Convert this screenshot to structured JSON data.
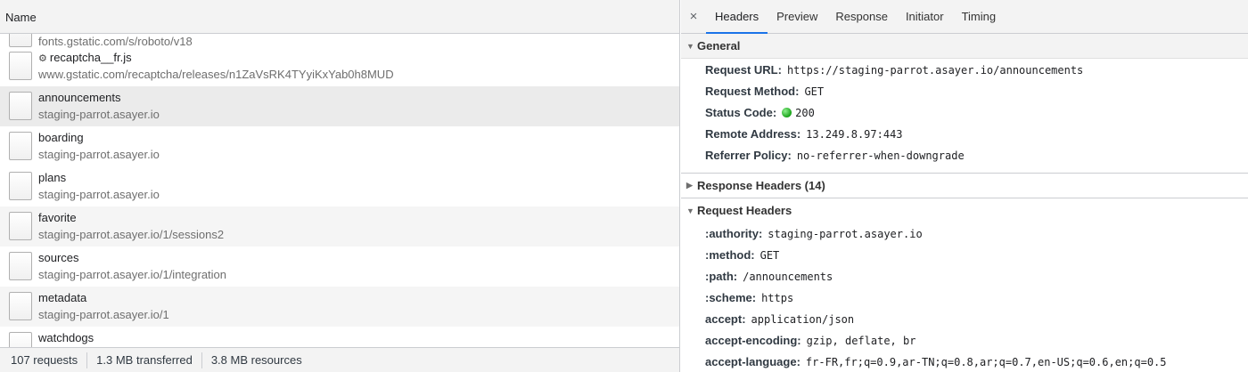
{
  "list": {
    "column_header": "Name",
    "rows": [
      {
        "name": "",
        "url": "fonts.gstatic.com/s/roboto/v18"
      },
      {
        "name": "recaptcha__fr.js",
        "url": "www.gstatic.com/recaptcha/releases/n1ZaVsRK4TYyiKxYab0h8MUD"
      },
      {
        "name": "announcements",
        "url": "staging-parrot.asayer.io"
      },
      {
        "name": "boarding",
        "url": "staging-parrot.asayer.io"
      },
      {
        "name": "plans",
        "url": "staging-parrot.asayer.io"
      },
      {
        "name": "favorite",
        "url": "staging-parrot.asayer.io/1/sessions2"
      },
      {
        "name": "sources",
        "url": "staging-parrot.asayer.io/1/integration"
      },
      {
        "name": "metadata",
        "url": "staging-parrot.asayer.io/1"
      },
      {
        "name": "watchdogs",
        "url": ""
      }
    ]
  },
  "footer": {
    "requests": "107 requests",
    "transferred": "1.3 MB transferred",
    "resources": "3.8 MB resources"
  },
  "tabs": {
    "close": "×",
    "items": [
      "Headers",
      "Preview",
      "Response",
      "Initiator",
      "Timing"
    ]
  },
  "general": {
    "title": "General",
    "request_url": {
      "key": "Request URL:",
      "value": "https://staging-parrot.asayer.io/announcements"
    },
    "request_method": {
      "key": "Request Method:",
      "value": "GET"
    },
    "status_code": {
      "key": "Status Code:",
      "value": "200"
    },
    "remote_address": {
      "key": "Remote Address:",
      "value": "13.249.8.97:443"
    },
    "referrer_policy": {
      "key": "Referrer Policy:",
      "value": "no-referrer-when-downgrade"
    }
  },
  "response_headers": {
    "title": "Response Headers (14)"
  },
  "request_headers": {
    "title": "Request Headers",
    "items": [
      {
        "key": ":authority:",
        "value": "staging-parrot.asayer.io"
      },
      {
        "key": ":method:",
        "value": "GET"
      },
      {
        "key": ":path:",
        "value": "/announcements"
      },
      {
        "key": ":scheme:",
        "value": "https"
      },
      {
        "key": "accept:",
        "value": "application/json"
      },
      {
        "key": "accept-encoding:",
        "value": "gzip, deflate, br"
      },
      {
        "key": "accept-language:",
        "value": "fr-FR,fr;q=0.9,ar-TN;q=0.8,ar;q=0.7,en-US;q=0.6,en;q=0.5"
      }
    ]
  },
  "colors": {
    "accent": "#1a73e8",
    "status_ok": "#19a319",
    "selected_row": "#ebebeb"
  }
}
